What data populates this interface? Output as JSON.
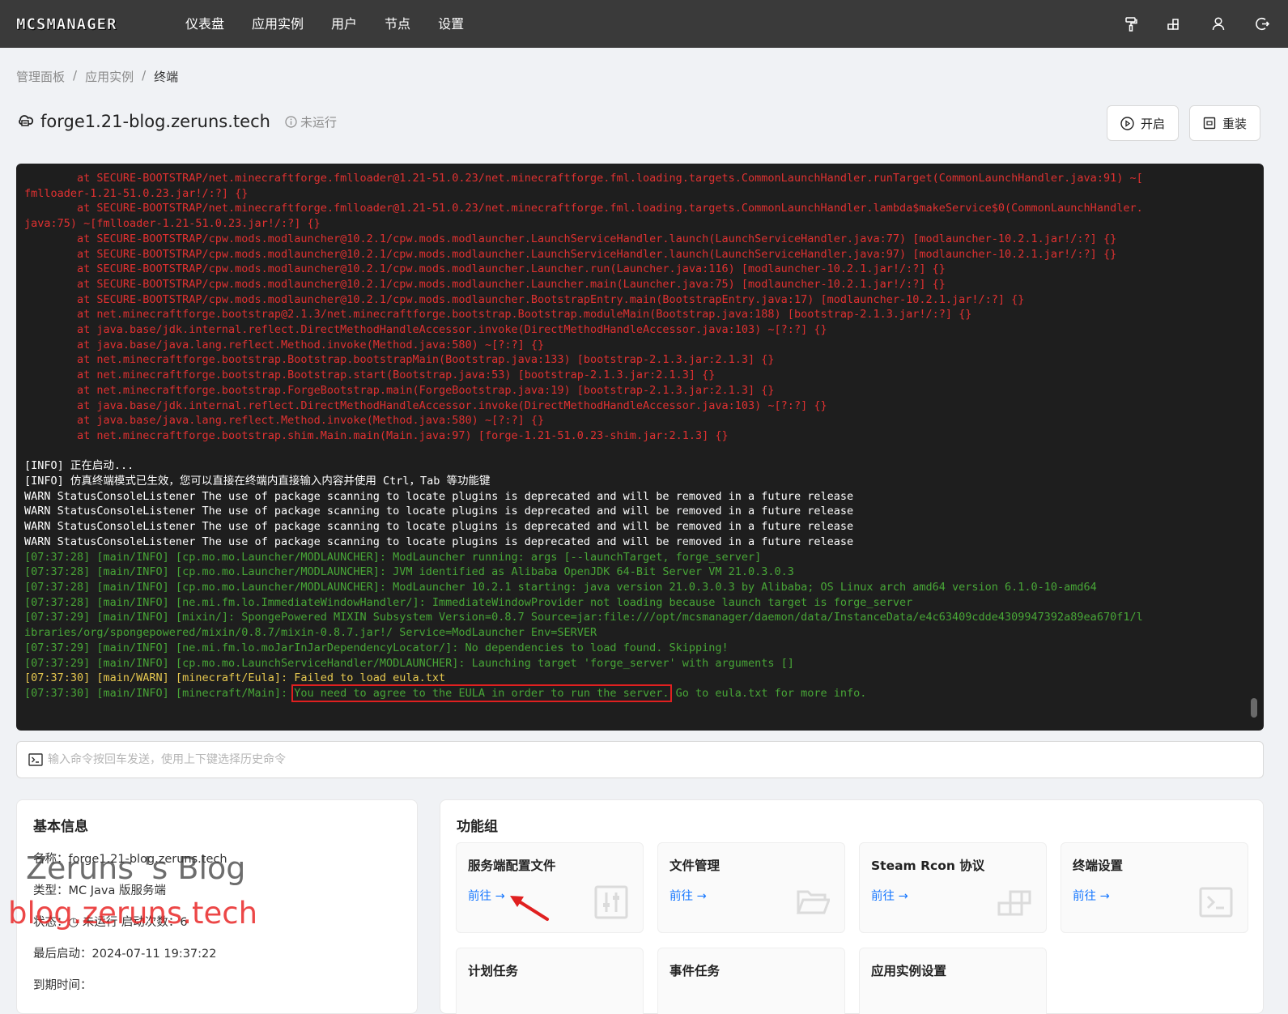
{
  "brand": {
    "logo_text": "MCSMANAGER"
  },
  "nav": {
    "items": [
      "仪表盘",
      "应用实例",
      "用户",
      "节点",
      "设置"
    ]
  },
  "breadcrumb": [
    "管理面板",
    "/",
    "应用实例",
    "/",
    "终端"
  ],
  "instance": {
    "name": "forge1.21-blog.zeruns.tech",
    "status": "未运行"
  },
  "actions": {
    "start": "开启",
    "reinstall": "重装"
  },
  "terminal": {
    "lines": [
      {
        "c": "red",
        "t": "        at SECURE-BOOTSTRAP/net.minecraftforge.fmlloader@1.21-51.0.23/net.minecraftforge.fml.loading.targets.CommonLaunchHandler.runTarget(CommonLaunchHandler.java:91) ~["
      },
      {
        "c": "red",
        "t": "fmlloader-1.21-51.0.23.jar!/:?] {}"
      },
      {
        "c": "red",
        "t": "        at SECURE-BOOTSTRAP/net.minecraftforge.fmlloader@1.21-51.0.23/net.minecraftforge.fml.loading.targets.CommonLaunchHandler.lambda$makeService$0(CommonLaunchHandler."
      },
      {
        "c": "red",
        "t": "java:75) ~[fmlloader-1.21-51.0.23.jar!/:?] {}"
      },
      {
        "c": "red",
        "t": "        at SECURE-BOOTSTRAP/cpw.mods.modlauncher@10.2.1/cpw.mods.modlauncher.LaunchServiceHandler.launch(LaunchServiceHandler.java:77) [modlauncher-10.2.1.jar!/:?] {}"
      },
      {
        "c": "red",
        "t": "        at SECURE-BOOTSTRAP/cpw.mods.modlauncher@10.2.1/cpw.mods.modlauncher.LaunchServiceHandler.launch(LaunchServiceHandler.java:97) [modlauncher-10.2.1.jar!/:?] {}"
      },
      {
        "c": "red",
        "t": "        at SECURE-BOOTSTRAP/cpw.mods.modlauncher@10.2.1/cpw.mods.modlauncher.Launcher.run(Launcher.java:116) [modlauncher-10.2.1.jar!/:?] {}"
      },
      {
        "c": "red",
        "t": "        at SECURE-BOOTSTRAP/cpw.mods.modlauncher@10.2.1/cpw.mods.modlauncher.Launcher.main(Launcher.java:75) [modlauncher-10.2.1.jar!/:?] {}"
      },
      {
        "c": "red",
        "t": "        at SECURE-BOOTSTRAP/cpw.mods.modlauncher@10.2.1/cpw.mods.modlauncher.BootstrapEntry.main(BootstrapEntry.java:17) [modlauncher-10.2.1.jar!/:?] {}"
      },
      {
        "c": "red",
        "t": "        at net.minecraftforge.bootstrap@2.1.3/net.minecraftforge.bootstrap.Bootstrap.moduleMain(Bootstrap.java:188) [bootstrap-2.1.3.jar!/:?] {}"
      },
      {
        "c": "red",
        "t": "        at java.base/jdk.internal.reflect.DirectMethodHandleAccessor.invoke(DirectMethodHandleAccessor.java:103) ~[?:?] {}"
      },
      {
        "c": "red",
        "t": "        at java.base/java.lang.reflect.Method.invoke(Method.java:580) ~[?:?] {}"
      },
      {
        "c": "red",
        "t": "        at net.minecraftforge.bootstrap.Bootstrap.bootstrapMain(Bootstrap.java:133) [bootstrap-2.1.3.jar:2.1.3] {}"
      },
      {
        "c": "red",
        "t": "        at net.minecraftforge.bootstrap.Bootstrap.start(Bootstrap.java:53) [bootstrap-2.1.3.jar:2.1.3] {}"
      },
      {
        "c": "red",
        "t": "        at net.minecraftforge.bootstrap.ForgeBootstrap.main(ForgeBootstrap.java:19) [bootstrap-2.1.3.jar:2.1.3] {}"
      },
      {
        "c": "red",
        "t": "        at java.base/jdk.internal.reflect.DirectMethodHandleAccessor.invoke(DirectMethodHandleAccessor.java:103) ~[?:?] {}"
      },
      {
        "c": "red",
        "t": "        at java.base/java.lang.reflect.Method.invoke(Method.java:580) ~[?:?] {}"
      },
      {
        "c": "red",
        "t": "        at net.minecraftforge.bootstrap.shim.Main.main(Main.java:97) [forge-1.21-51.0.23-shim.jar:2.1.3] {}"
      },
      {
        "c": "white",
        "t": " "
      },
      {
        "c": "white",
        "t": "[INFO] 正在启动..."
      },
      {
        "c": "white",
        "t": "[INFO] 仿真终端模式已生效，您可以直接在终端内直接输入内容并使用 Ctrl，Tab 等功能键"
      },
      {
        "c": "white",
        "t": "WARN StatusConsoleListener The use of package scanning to locate plugins is deprecated and will be removed in a future release"
      },
      {
        "c": "white",
        "t": "WARN StatusConsoleListener The use of package scanning to locate plugins is deprecated and will be removed in a future release"
      },
      {
        "c": "white",
        "t": "WARN StatusConsoleListener The use of package scanning to locate plugins is deprecated and will be removed in a future release"
      },
      {
        "c": "white",
        "t": "WARN StatusConsoleListener The use of package scanning to locate plugins is deprecated and will be removed in a future release"
      },
      {
        "c": "green",
        "t": "[07:37:28] [main/INFO] [cp.mo.mo.Launcher/MODLAUNCHER]: ModLauncher running: args [--launchTarget, forge_server]"
      },
      {
        "c": "green",
        "t": "[07:37:28] [main/INFO] [cp.mo.mo.Launcher/MODLAUNCHER]: JVM identified as Alibaba OpenJDK 64-Bit Server VM 21.0.3.0.3"
      },
      {
        "c": "green",
        "t": "[07:37:28] [main/INFO] [cp.mo.mo.Launcher/MODLAUNCHER]: ModLauncher 10.2.1 starting: java version 21.0.3.0.3 by Alibaba; OS Linux arch amd64 version 6.1.0-10-amd64"
      },
      {
        "c": "green",
        "t": "[07:37:28] [main/INFO] [ne.mi.fm.lo.ImmediateWindowHandler/]: ImmediateWindowProvider not loading because launch target is forge_server"
      },
      {
        "c": "green",
        "t": "[07:37:29] [main/INFO] [mixin/]: SpongePowered MIXIN Subsystem Version=0.8.7 Source=jar:file:///opt/mcsmanager/daemon/data/InstanceData/e4c63409cdde4309947392a89ea670f1/l"
      },
      {
        "c": "green",
        "t": "ibraries/org/spongepowered/mixin/0.8.7/mixin-0.8.7.jar!/ Service=ModLauncher Env=SERVER"
      },
      {
        "c": "green",
        "t": "[07:37:29] [main/INFO] [ne.mi.fm.lo.moJarInJarDependencyLocator/]: No dependencies to load found. Skipping!"
      },
      {
        "c": "green",
        "t": "[07:37:29] [main/INFO] [cp.mo.mo.LaunchServiceHandler/MODLAUNCHER]: Launching target 'forge_server' with arguments []"
      },
      {
        "c": "yellow",
        "t": "[07:37:30] [main/WARN] [minecraft/Eula]: Failed to load eula.txt"
      }
    ],
    "last_line": {
      "prefix": "[07:37:30] [main/INFO] [minecraft/Main]: ",
      "highlight": "You need to agree to the EULA in order to run the server.",
      "suffix": " Go to eula.txt for more info."
    }
  },
  "command": {
    "placeholder": "输入命令按回车发送，使用上下键选择历史命令"
  },
  "basic_info": {
    "title": "基本信息",
    "name": "名称：forge1.21-blog.zeruns.tech",
    "type": "类型：MC Java 版服务端",
    "state": "状态：◷ 未运行  启动次数：6",
    "last_start": "最后启动：2024-07-11 19:37:22",
    "expire": "到期时间："
  },
  "functions": {
    "title": "功能组",
    "go_label": "前往 →",
    "tiles": [
      "服务端配置文件",
      "文件管理",
      "Steam Rcon 协议",
      "终端设置",
      "计划任务",
      "事件任务",
      "应用实例设置"
    ]
  },
  "watermark": {
    "line1": "Zeruns 's Blog",
    "line2": "blog.zeruns.tech"
  },
  "colors": {
    "topbar": "#3a3a3a",
    "terminal_bg": "#1e1e1e",
    "link": "#1677ff",
    "highlight_box": "#e02020"
  }
}
